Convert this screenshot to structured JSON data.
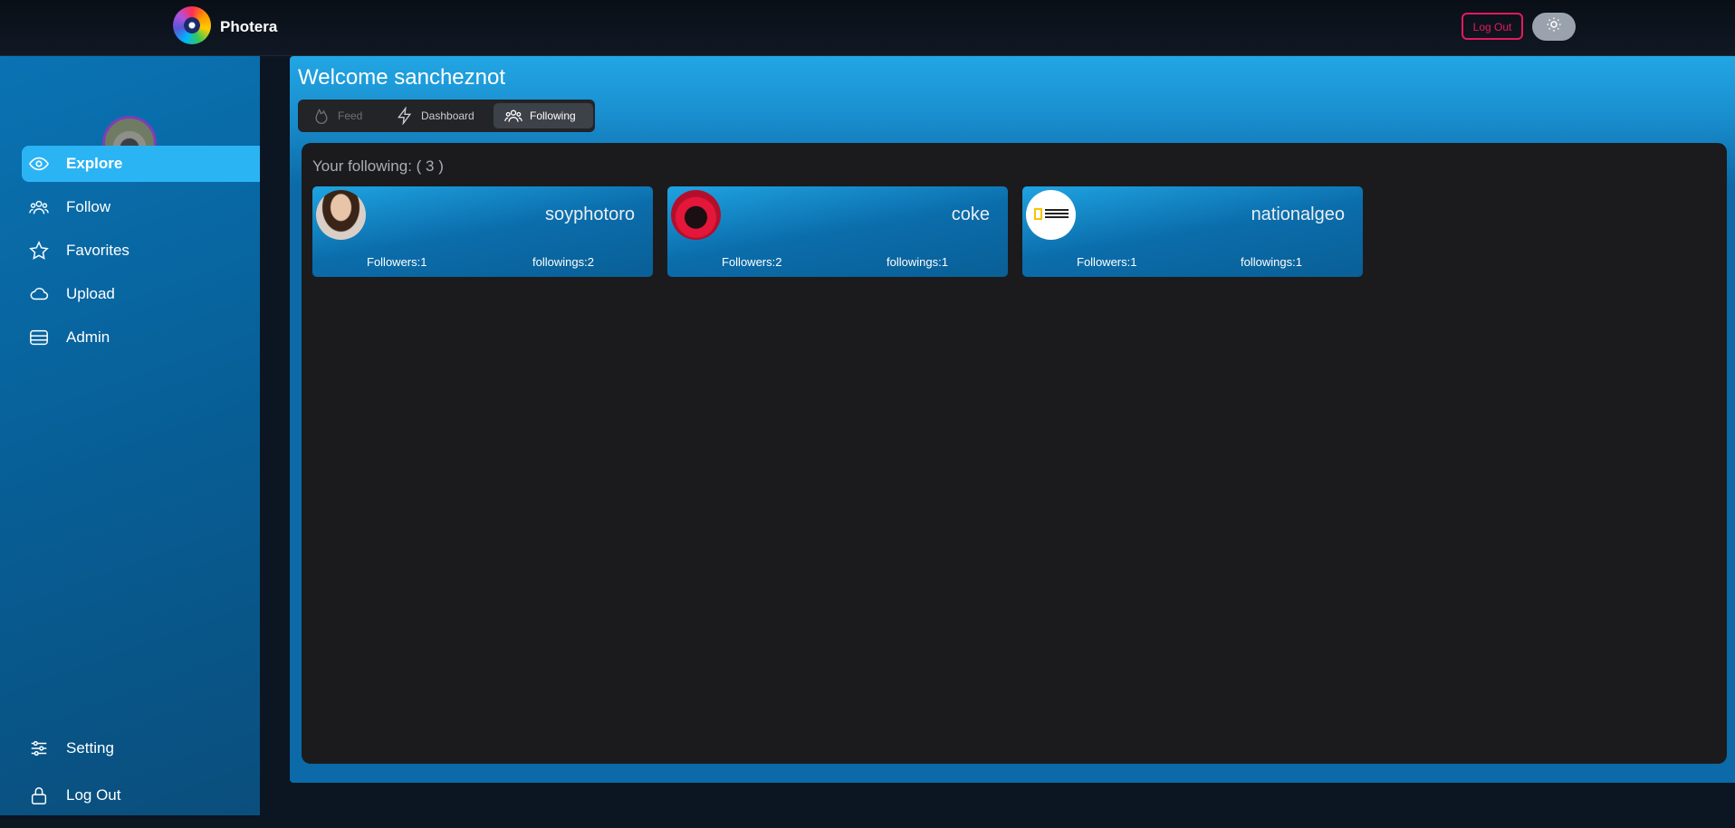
{
  "app": {
    "name": "Photera",
    "logout_label": "Log Out"
  },
  "sidebar": {
    "items": [
      {
        "label": "Explore",
        "icon": "eye-icon"
      },
      {
        "label": "Follow",
        "icon": "users-icon"
      },
      {
        "label": "Favorites",
        "icon": "star-icon"
      },
      {
        "label": "Upload",
        "icon": "cloud-icon"
      },
      {
        "label": "Admin",
        "icon": "database-icon"
      }
    ],
    "bottom": [
      {
        "label": "Setting",
        "icon": "sliders-icon"
      },
      {
        "label": "Log Out",
        "icon": "lock-icon"
      }
    ]
  },
  "main": {
    "welcome": "Welcome sancheznot",
    "tabs": [
      {
        "label": "Feed",
        "state": "disabled"
      },
      {
        "label": "Dashboard",
        "state": "normal"
      },
      {
        "label": "Following",
        "state": "active"
      }
    ],
    "following_title": "Your following: ( 3 )",
    "cards": [
      {
        "name": "soyphotoro",
        "followers": "Followers:1",
        "followings": "followings:2"
      },
      {
        "name": "coke",
        "followers": "Followers:2",
        "followings": "followings:1"
      },
      {
        "name": "nationalgeo",
        "followers": "Followers:1",
        "followings": "followings:1"
      }
    ]
  },
  "colors": {
    "accent": "#2bb4f4",
    "logout_red": "#e6195e",
    "panel": "#1b1b1d"
  }
}
